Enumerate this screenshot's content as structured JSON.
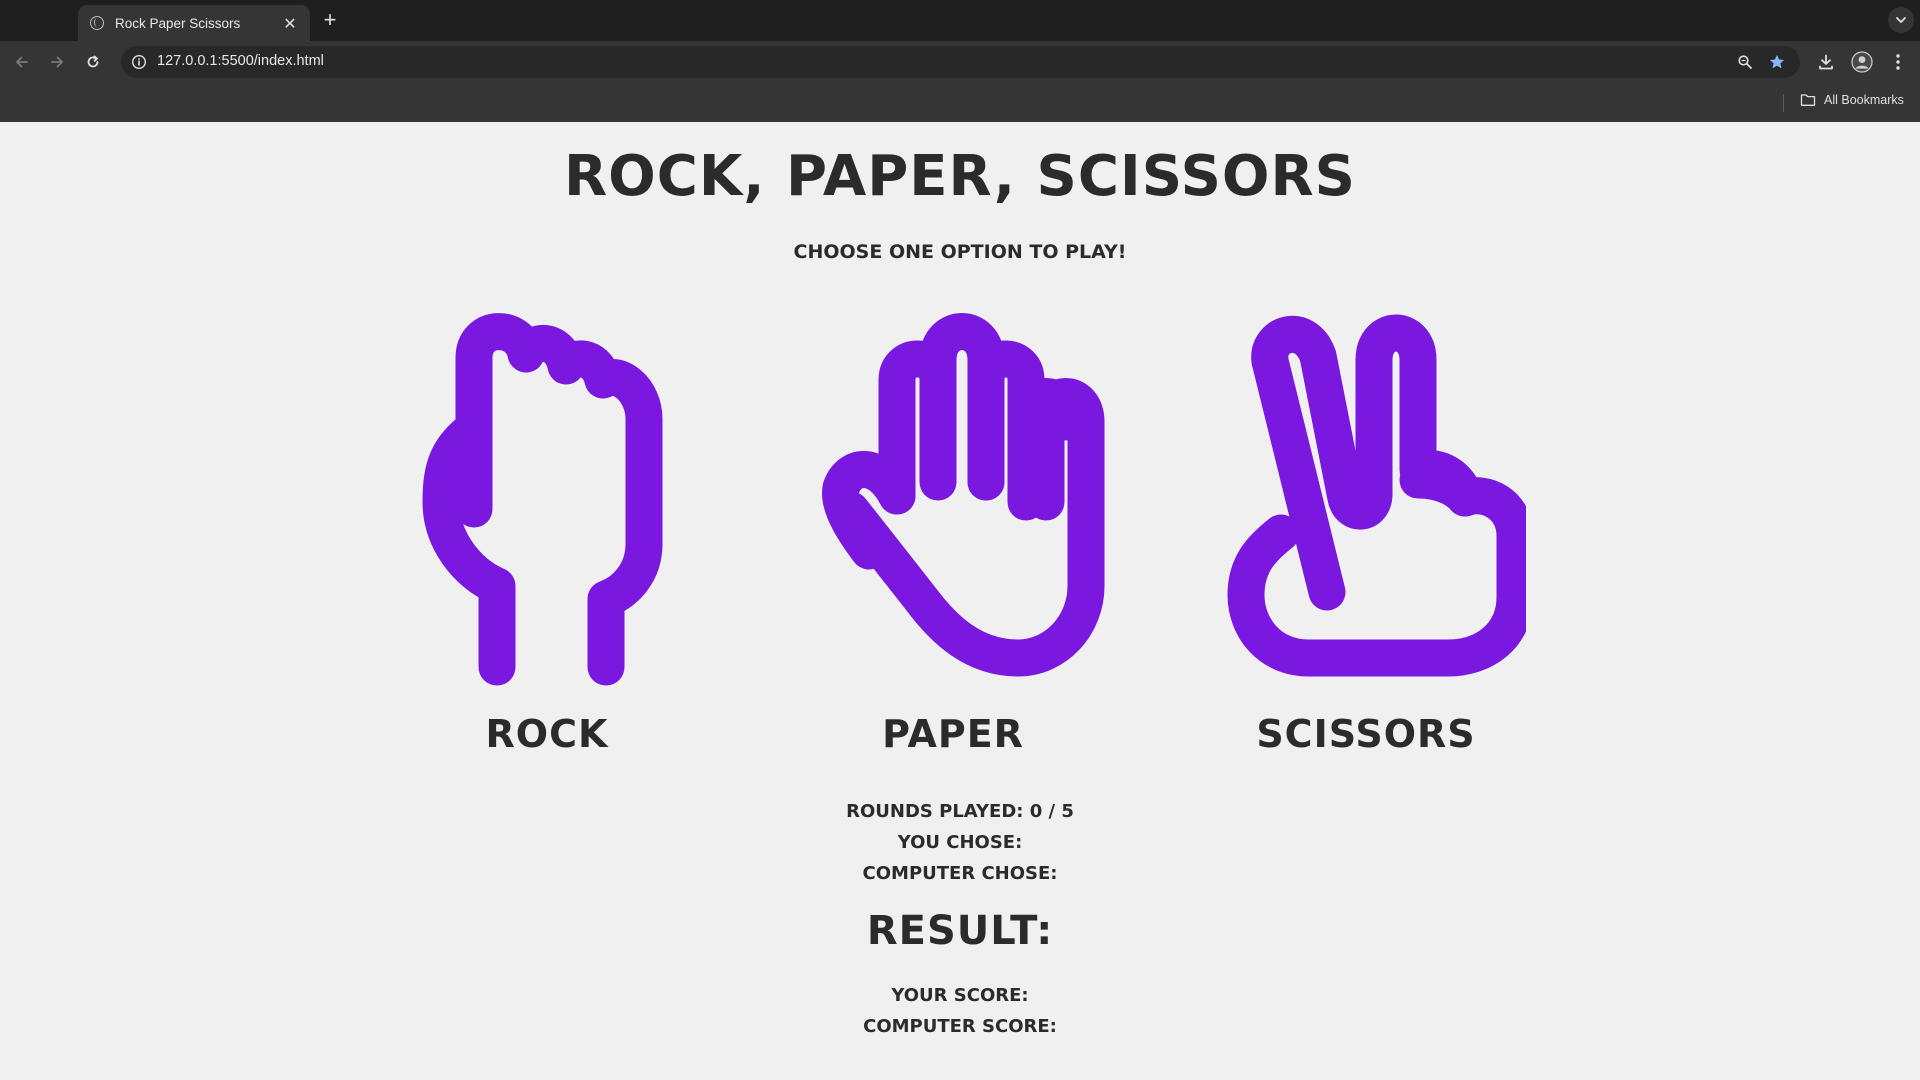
{
  "browser": {
    "tab_title": "Rock Paper Scissors",
    "url": "127.0.0.1:5500/index.html",
    "bookmarks_label": "All Bookmarks",
    "icons": [
      "globe-icon",
      "close-icon",
      "plus-icon",
      "chevron-down-icon",
      "back-arrow-icon",
      "forward-arrow-icon",
      "reload-icon",
      "info-icon",
      "zoom-icon",
      "star-icon",
      "download-icon",
      "profile-icon",
      "kebab-menu-icon",
      "folder-icon"
    ],
    "accent_color": "#8ab4f8"
  },
  "game": {
    "title": "Rock, Paper, Scissors",
    "subtitle": "Choose one option to play!",
    "hand_color": "#7a18e0",
    "choices": [
      {
        "label": "Rock",
        "icon": "fist-icon"
      },
      {
        "label": "Paper",
        "icon": "open-hand-icon"
      },
      {
        "label": "Scissors",
        "icon": "peace-hand-icon"
      }
    ],
    "rounds_played": "Rounds played: 0 / 5",
    "you_chose": "You chose:",
    "computer_chose": "Computer chose:",
    "result": "Result:",
    "your_score": "Your score:",
    "computer_score": "Computer score:"
  }
}
